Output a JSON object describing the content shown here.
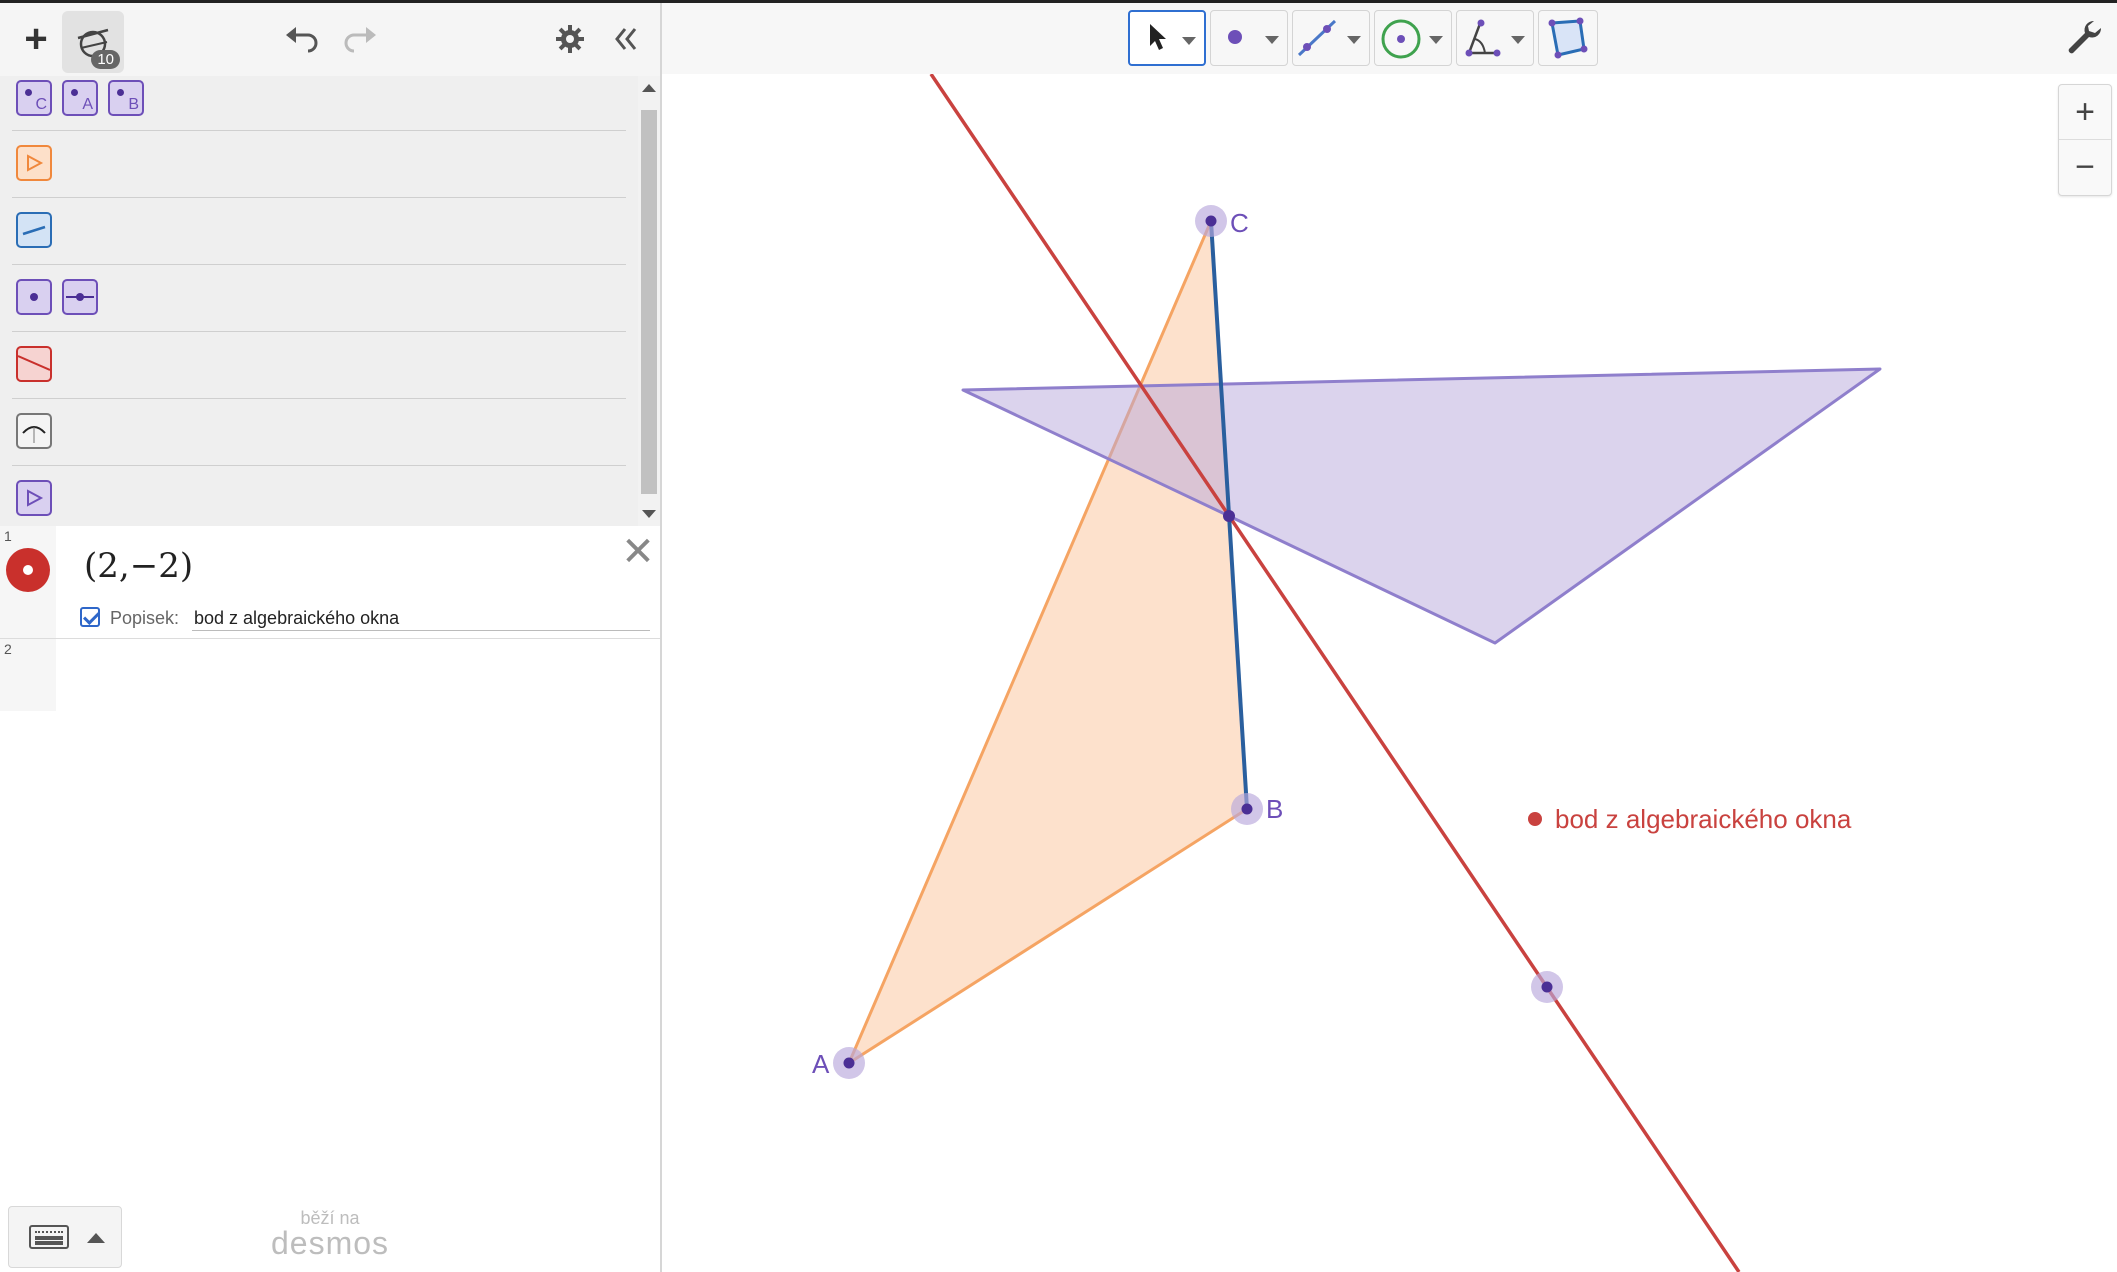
{
  "header": {
    "add_label": "+",
    "construction_badge": "10"
  },
  "catalog": {
    "row0_letters": [
      "C",
      "A",
      "B"
    ]
  },
  "algebra": {
    "row1": {
      "number": "1",
      "expression": "(2,−2)",
      "caption_label": "Popisek:",
      "caption_value": "bod z algebraického okna",
      "color": "#c9302c"
    },
    "row2": {
      "number": "2"
    }
  },
  "footer": {
    "powered_small": "běží na",
    "powered_big": "desmos"
  },
  "zoom": {
    "in": "+",
    "out": "−"
  },
  "canvas": {
    "labels": {
      "A": "A",
      "B": "B",
      "C": "C",
      "point_caption": "bod z algebraického okna"
    }
  },
  "colors": {
    "purple": "#6d4fb8",
    "orange": "#f0883c",
    "blue": "#2a6db5",
    "red": "#c9302c",
    "accent": "#2f6fd1"
  }
}
